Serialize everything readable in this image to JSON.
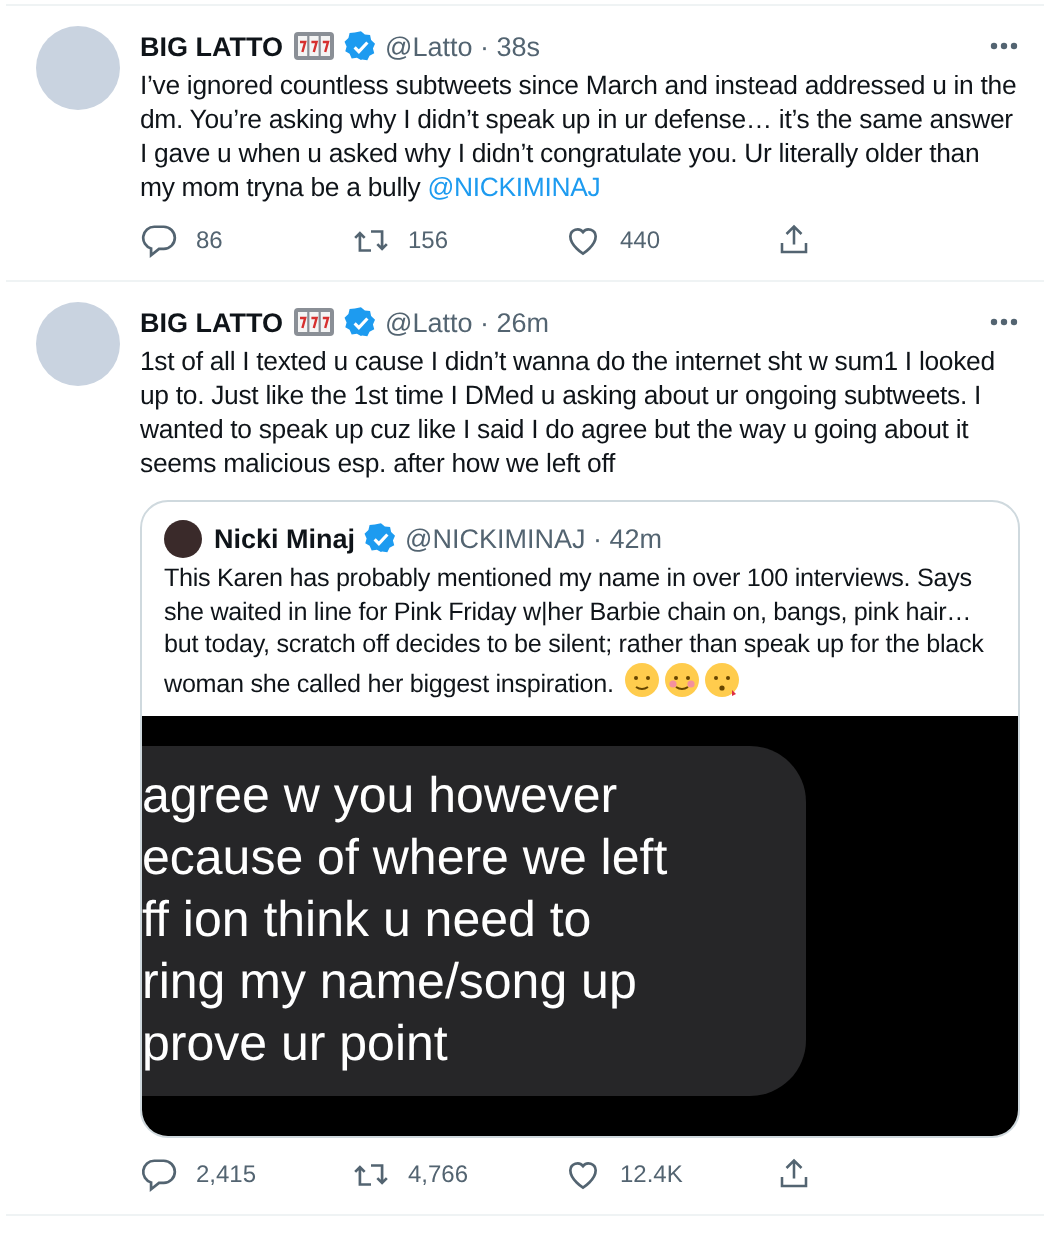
{
  "tweets": [
    {
      "author": {
        "name": "BIG LATTO",
        "verified": true,
        "meta": "@Latto · 38s"
      },
      "text": "I’ve ignored countless subtweets since March and instead addressed u in the dm. You’re asking why I didn’t speak up in ur defense… it’s the same answer I gave u when u asked why I didn’t congratulate you. Ur literally older than my mom tryna be a bully",
      "mention": "@NICKIMINAJ",
      "stats": {
        "replies": "86",
        "retweets": "156",
        "likes": "440"
      }
    },
    {
      "author": {
        "name": "BIG LATTO",
        "verified": true,
        "meta": "@Latto · 26m"
      },
      "text": "1st of all I texted u cause I didn’t wanna do the internet sht w sum1 I looked up to. Just like the 1st time I DMed u asking about ur ongoing subtweets. I wanted to speak up cuz like I said I do agree but the way u going about it seems malicious esp. after how we left off",
      "quote": {
        "author": {
          "name": "Nicki Minaj",
          "verified": true,
          "meta": "@NICKIMINAJ · 42m"
        },
        "text": "This Karen has probably mentioned my name in over 100 interviews. Says she waited in line for Pink Friday w|her Barbie chain on, bangs, pink hair…but today, scratch off decides to be silent; rather than speak up for the black woman she called her biggest inspiration.",
        "screenshot_lines": [
          "agree w you however",
          "ecause of where we left",
          "ff ion think u need to",
          "ring my name/song up",
          "prove ur point"
        ]
      },
      "stats": {
        "replies": "2,415",
        "retweets": "4,766",
        "likes": "12.4K"
      }
    }
  ]
}
